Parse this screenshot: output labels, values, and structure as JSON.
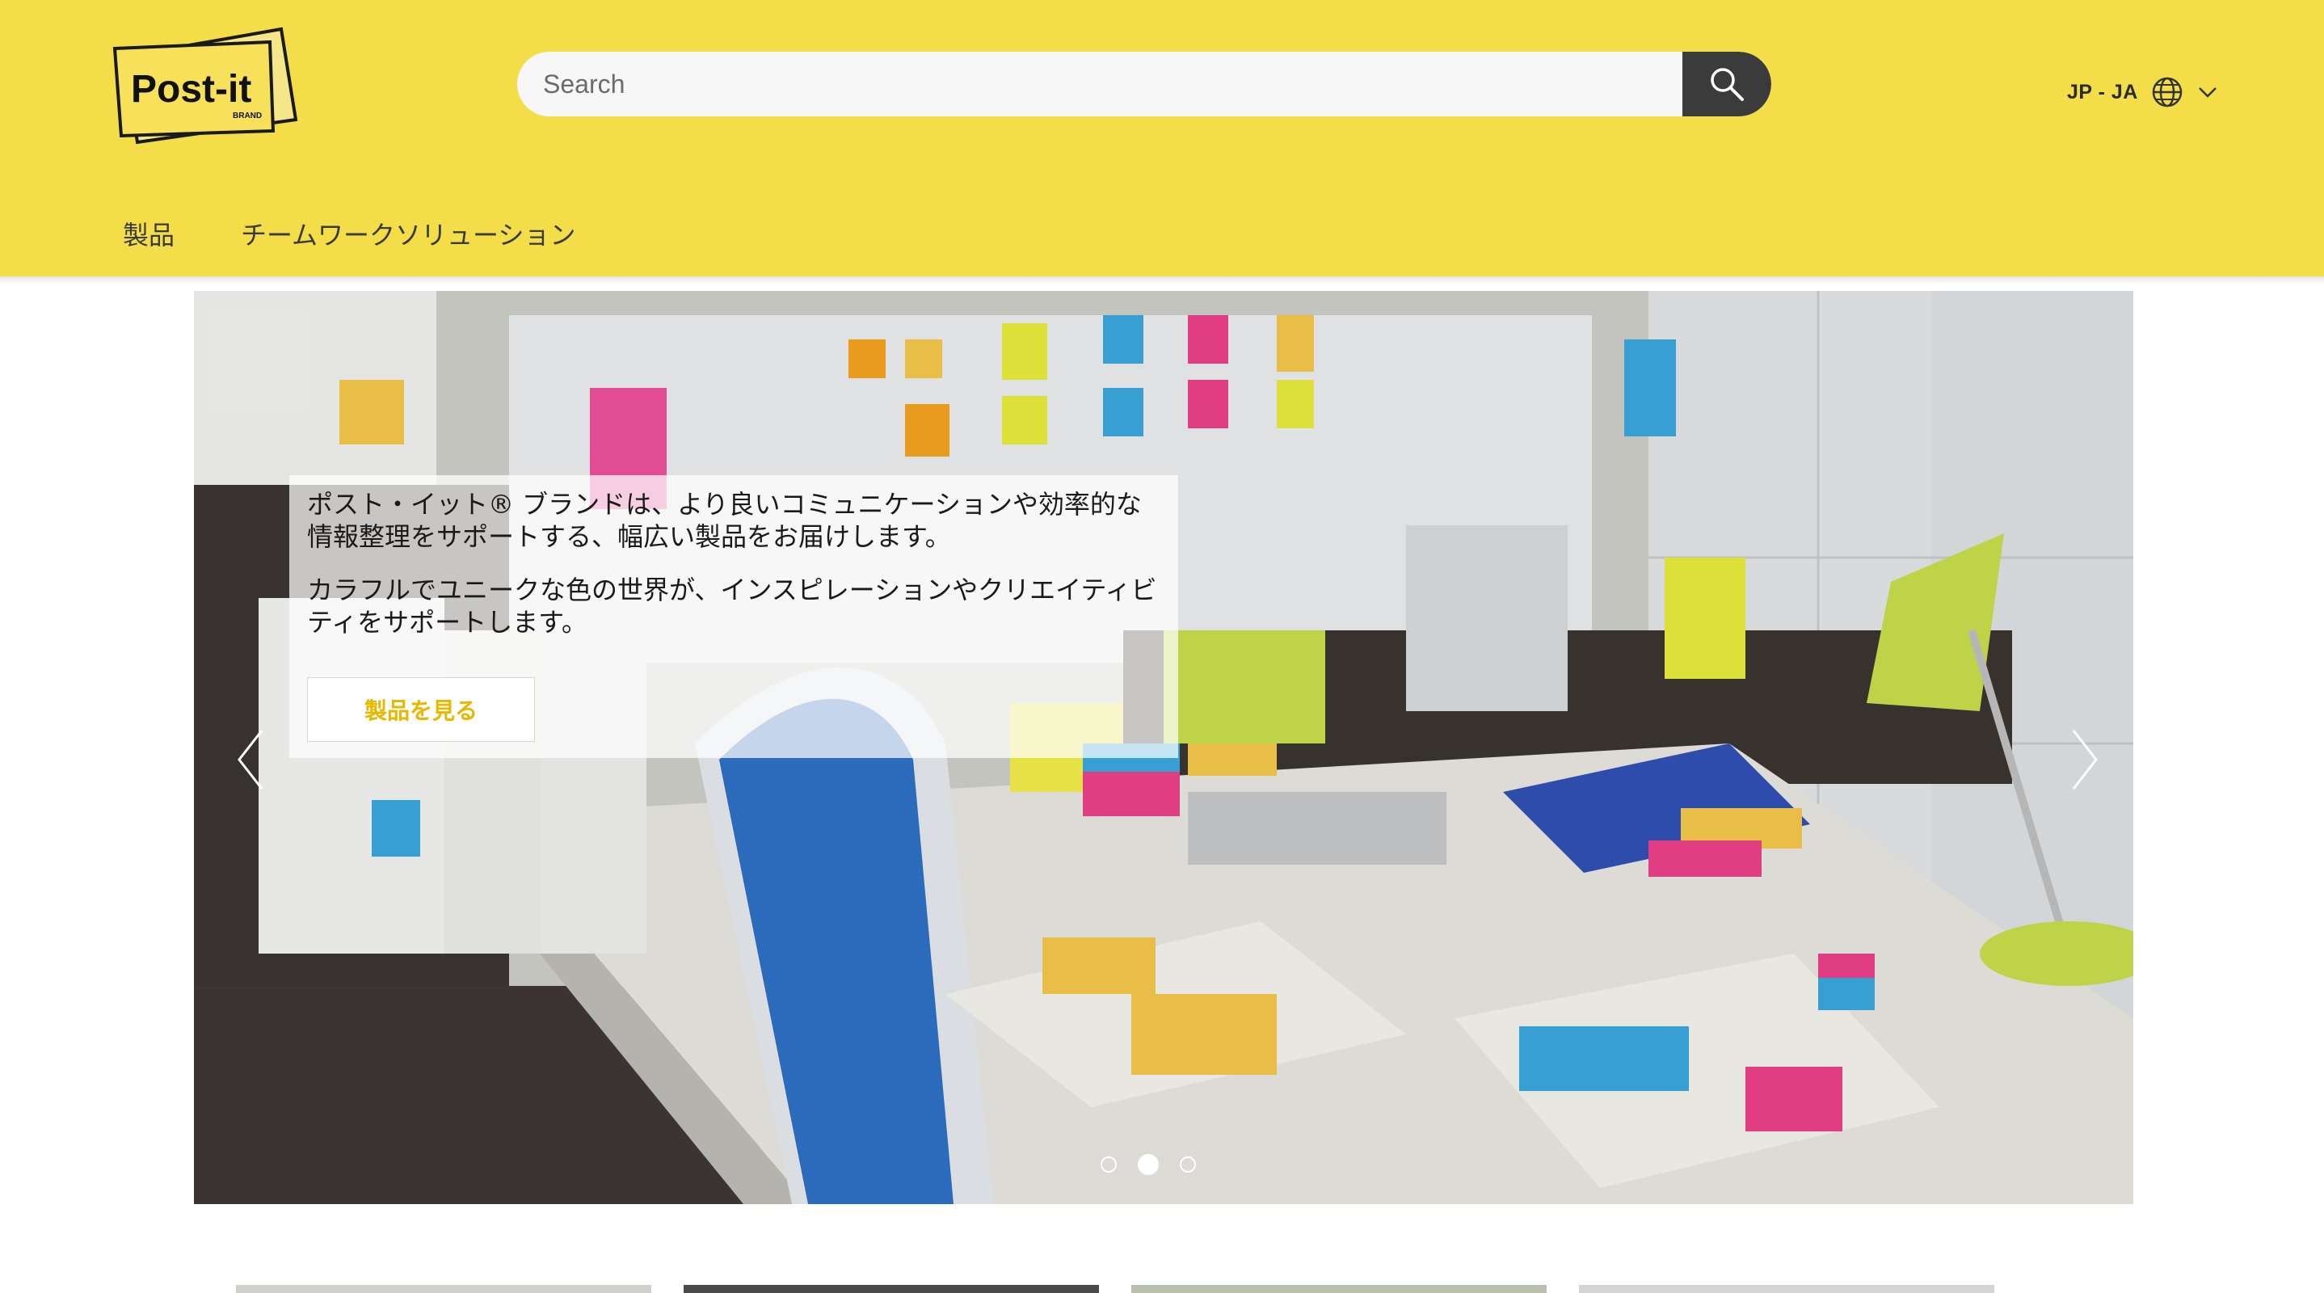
{
  "header": {
    "logo_text": "Post-it",
    "logo_sub": "BRAND",
    "search": {
      "placeholder": "Search",
      "value": ""
    },
    "locale": {
      "label": "JP - JA"
    }
  },
  "nav": {
    "items": [
      {
        "label": "製品"
      },
      {
        "label": "チームワークソリューション"
      }
    ]
  },
  "hero": {
    "paragraph_1": "ポスト・イット® ブランドは、より良いコミュニケーションや効率的な情報整理をサポートする、幅広い製品をお届けします。",
    "paragraph_2": "カラフルでユニークな色の世界が、インスピレーションやクリエイティビティをサポートします。",
    "cta_label": "製品を見る",
    "slides": [
      {
        "active": false
      },
      {
        "active": true
      },
      {
        "active": false
      }
    ]
  },
  "colors": {
    "header_bg": "#f3de4a",
    "search_button": "#3b3b3b",
    "cta_text": "#e6b800"
  },
  "icons": [
    "search-icon",
    "globe-icon",
    "chevron-down-icon",
    "chevron-left-icon",
    "chevron-right-icon"
  ]
}
